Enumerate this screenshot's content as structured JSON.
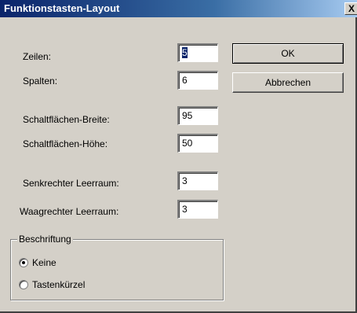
{
  "window": {
    "title": "Funktionstasten-Layout",
    "close_label": "X"
  },
  "fields": [
    {
      "label": "Zeilen:",
      "value": "5",
      "selected": true
    },
    {
      "label": "Spalten:",
      "value": "6"
    },
    {
      "label": "Schaltflächen-Breite:",
      "value": "95"
    },
    {
      "label": "Schaltflächen-Höhe:",
      "value": "50"
    },
    {
      "label": "Senkrechter Leerraum:",
      "value": "3"
    },
    {
      "label": "Waagrechter Leerraum:",
      "value": "3"
    }
  ],
  "buttons": {
    "ok": "OK",
    "cancel": "Abbrechen"
  },
  "group": {
    "title": "Beschriftung",
    "options": [
      {
        "label": "Keine",
        "checked": true
      },
      {
        "label": "Tastenkürzel",
        "checked": false
      }
    ]
  }
}
